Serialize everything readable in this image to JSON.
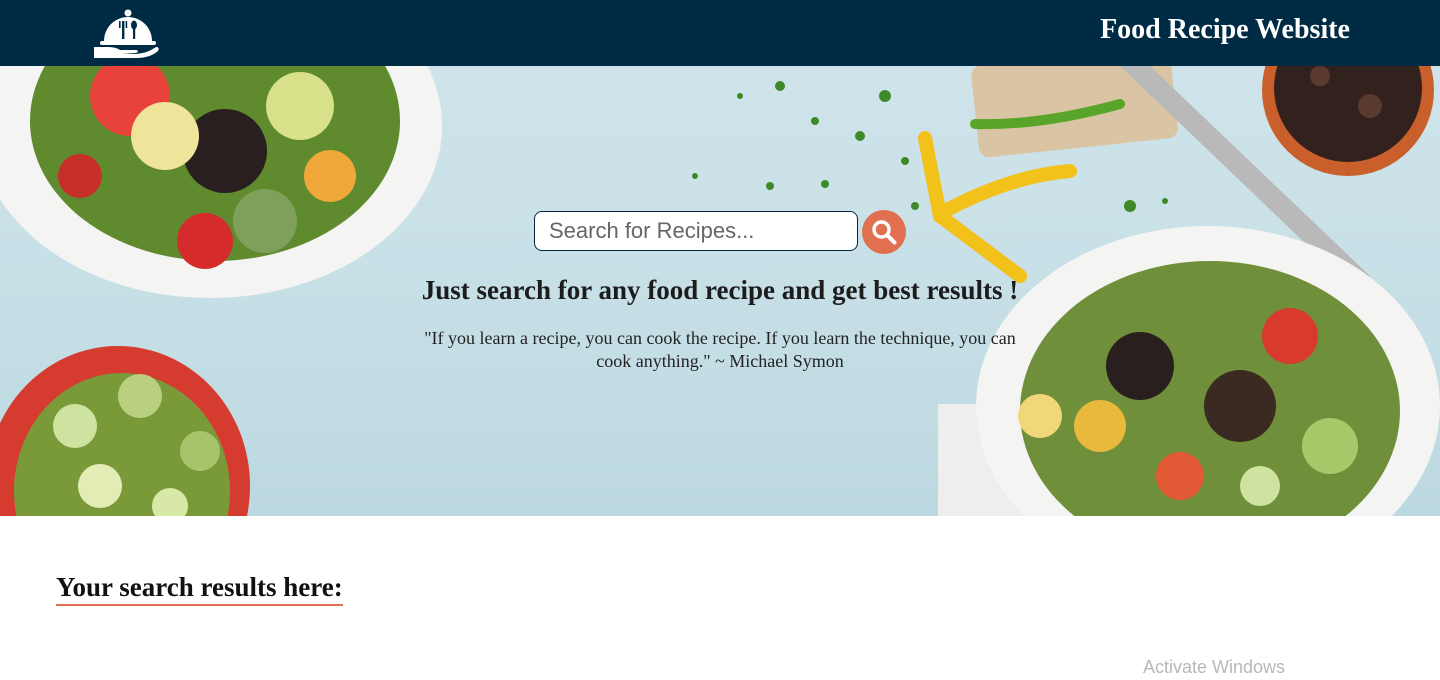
{
  "header": {
    "title": "Food Recipe Website",
    "logo_icon": "cloche-fork-spoon-hand-icon",
    "background_color": "#002b45"
  },
  "hero": {
    "search": {
      "placeholder": "Search for Recipes...",
      "value": "",
      "button_icon": "magnifier-icon",
      "button_color": "#e07050"
    },
    "tagline": "Just search for any food recipe and get best results !",
    "quote": "\"If you learn a recipe, you can cook the recipe. If you learn the technique, you can cook anything.\" ~ Michael Symon"
  },
  "results": {
    "heading": "Your search results here:",
    "underline_color": "#e07050"
  },
  "os_watermark": "Activate Windows"
}
